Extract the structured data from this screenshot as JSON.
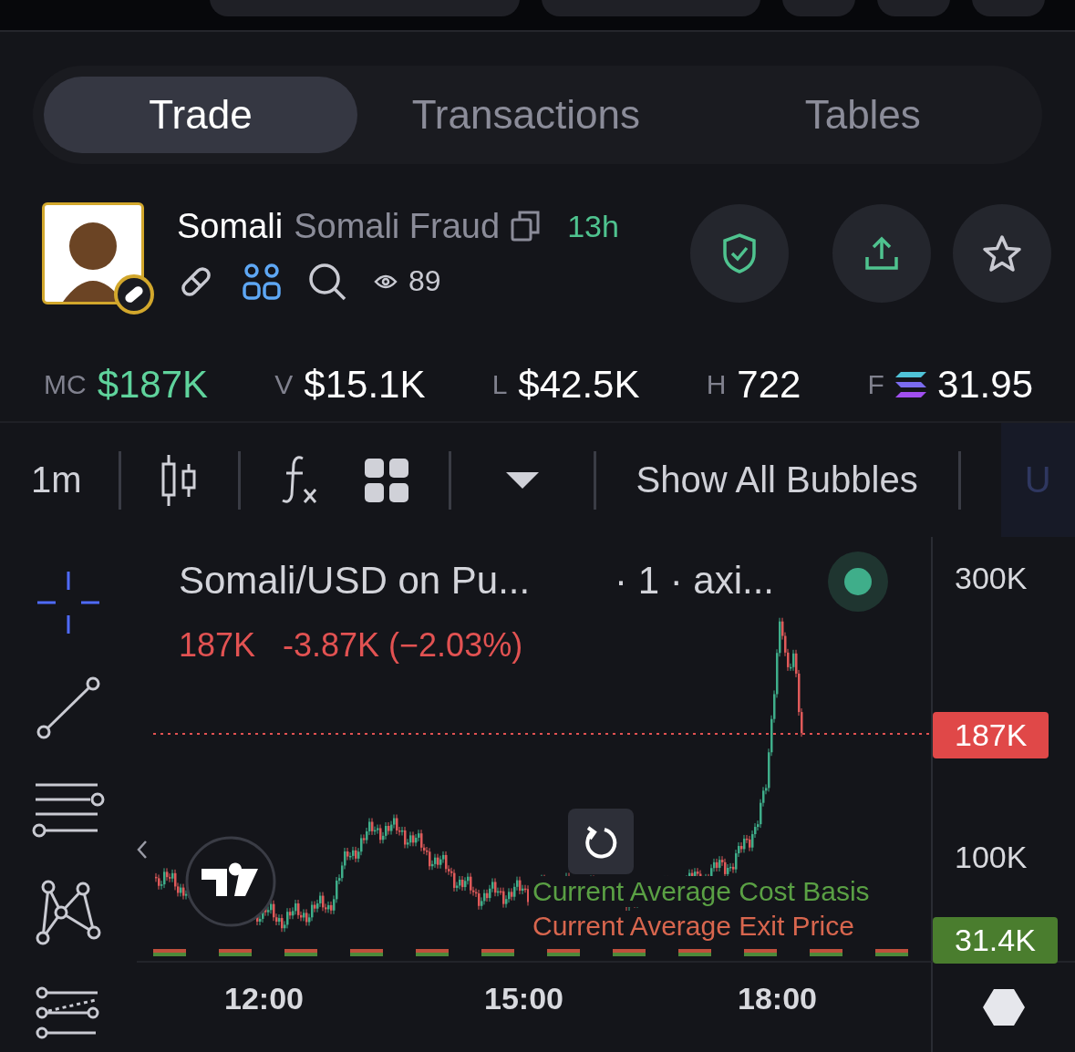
{
  "tabs": [
    {
      "label": "Trade",
      "selected": true
    },
    {
      "label": "Transactions",
      "selected": false
    },
    {
      "label": "Tables",
      "selected": false
    }
  ],
  "token": {
    "symbol": "Somali",
    "name": "Somali Fraud",
    "age": "13h",
    "views": "89"
  },
  "stats": [
    {
      "label": "MC",
      "value": "$187K",
      "kind": "accent"
    },
    {
      "label": "V",
      "value": "$15.1K",
      "kind": "plain"
    },
    {
      "label": "L",
      "value": "$42.5K",
      "kind": "plain"
    },
    {
      "label": "H",
      "value": "722",
      "kind": "plain"
    },
    {
      "label": "F",
      "value": "31.95",
      "kind": "token"
    }
  ],
  "toolbar": {
    "interval": "1m",
    "bubbles_button": "Show All Bubbles",
    "cut_label": "U"
  },
  "drawing_tools": [
    {
      "kind": "crosshair",
      "selected": true
    },
    {
      "kind": "trendline",
      "selected": false
    },
    {
      "kind": "hlines",
      "selected": false
    },
    {
      "kind": "pattern",
      "selected": false
    },
    {
      "kind": "fib",
      "selected": false
    }
  ],
  "chart": {
    "legend_title": "Somali/USD on Pu...",
    "legend_interval": "· 1 · axi...",
    "last": "187K",
    "change": "-3.87K (−2.03%)",
    "y_labels": [
      "300K",
      "100K"
    ],
    "price_tag": "187K",
    "basis_tag": "31.4K",
    "overlay_labels": [
      "Current Average Cost Basis",
      "Current Average Exit Price"
    ],
    "x_labels": [
      "12:00",
      "15:00",
      "18:00"
    ]
  }
}
